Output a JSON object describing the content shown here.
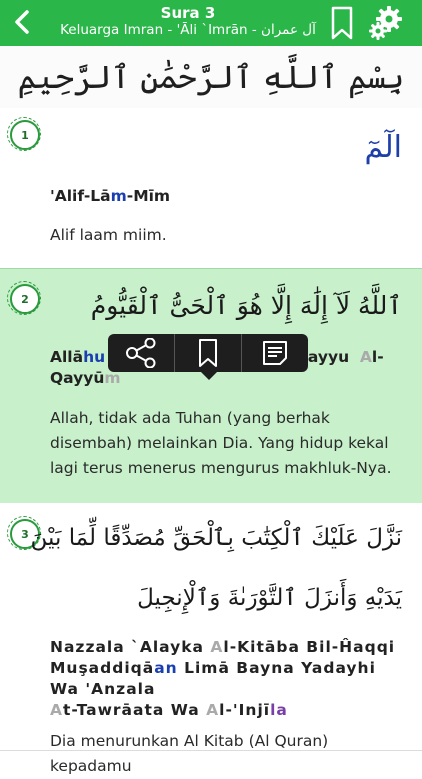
{
  "header": {
    "title": "Sura 3",
    "subtitle": "Keluarga Imran - 'Āli `Imrān - آل عمران",
    "bg_color": "#2bb64a"
  },
  "bismillah": {
    "text": "بِسْمِ ٱللَّهِ ٱلرَّحْمَٰنِ ٱلرَّحِيمِ"
  },
  "verses": [
    {
      "number": "1",
      "arabic": "الٓمٓ",
      "translit": [
        "'Alif-Lā",
        "m",
        "-Mīm"
      ],
      "translation": "Alif laam miim."
    },
    {
      "number": "2",
      "arabic": "ٱللَّهُ لَآ إِلَٰهَ إِلَّا هُوَ ٱلْحَىُّ ٱلْقَيُّومُ",
      "translit": [
        "Allā",
        "hu",
        "l-Ĥayyu",
        "A",
        "l-",
        "Qayyū",
        "m"
      ],
      "translation": "Allah, tidak ada Tuhan (yang berhak disembah) melainkan Dia. Yang hidup kekal lagi terus menerus mengurus makhluk-Nya."
    },
    {
      "number": "3",
      "arabic_line1": "نَزَّلَ عَلَيْكَ ٱلْكِتَٰبَ بِٱلْحَقِّ مُصَدِّقًا لِّمَا بَيْنَ",
      "arabic_line2": "يَدَيْهِ وَأَنزَلَ ٱلتَّوْرَىٰةَ وَٱلْإِنجِيلَ",
      "translit": [
        "Nazzala `Alayka ",
        "A",
        "l-Kitāba Bil-Ĥaqqi",
        "Muşaddiqā",
        "an",
        " Limā Bayna Yadayhi Wa 'Anzala",
        "A",
        "t-Tawrāata Wa ",
        "A",
        "l-'Injī",
        "la"
      ],
      "translation": "Dia menurunkan Al Kitab (Al Quran) kepadamu"
    }
  ],
  "popup": {
    "items": [
      "share-icon",
      "bookmark-icon",
      "note-icon"
    ]
  },
  "icons": {
    "back": "chevron-left-icon",
    "bookmark": "bookmark-icon",
    "settings": "gear-icon"
  }
}
